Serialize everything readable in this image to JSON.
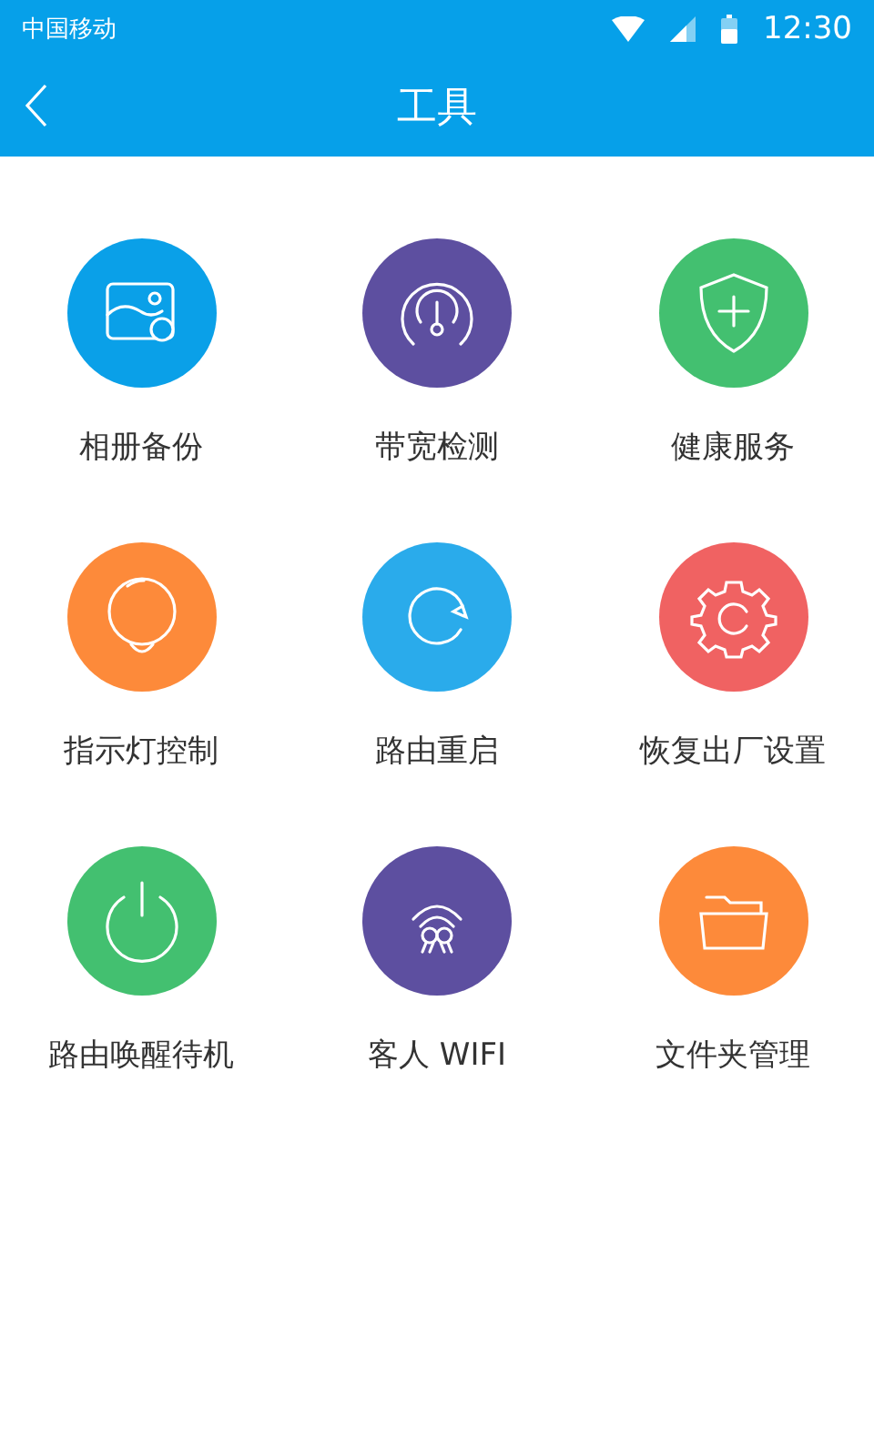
{
  "status_bar": {
    "carrier": "中国移动",
    "time": "12:30"
  },
  "header": {
    "title": "工具"
  },
  "tools": [
    {
      "label": "相册备份",
      "kind": "photo",
      "color": "#0aa0e8"
    },
    {
      "label": "带宽检测",
      "kind": "gauge",
      "color": "#5d4fa0"
    },
    {
      "label": "健康服务",
      "kind": "shield",
      "color": "#43c070"
    },
    {
      "label": "指示灯控制",
      "kind": "bulb",
      "color": "#fd8a3a"
    },
    {
      "label": "路由重启",
      "kind": "restart",
      "color": "#2aabeb"
    },
    {
      "label": "恢复出厂设置",
      "kind": "gear",
      "color": "#f06262"
    },
    {
      "label": "路由唤醒待机",
      "kind": "power",
      "color": "#43c070"
    },
    {
      "label": "客人 WIFI",
      "kind": "guests",
      "color": "#5d4fa0"
    },
    {
      "label": "文件夹管理",
      "kind": "folder",
      "color": "#fd8a3a"
    }
  ]
}
